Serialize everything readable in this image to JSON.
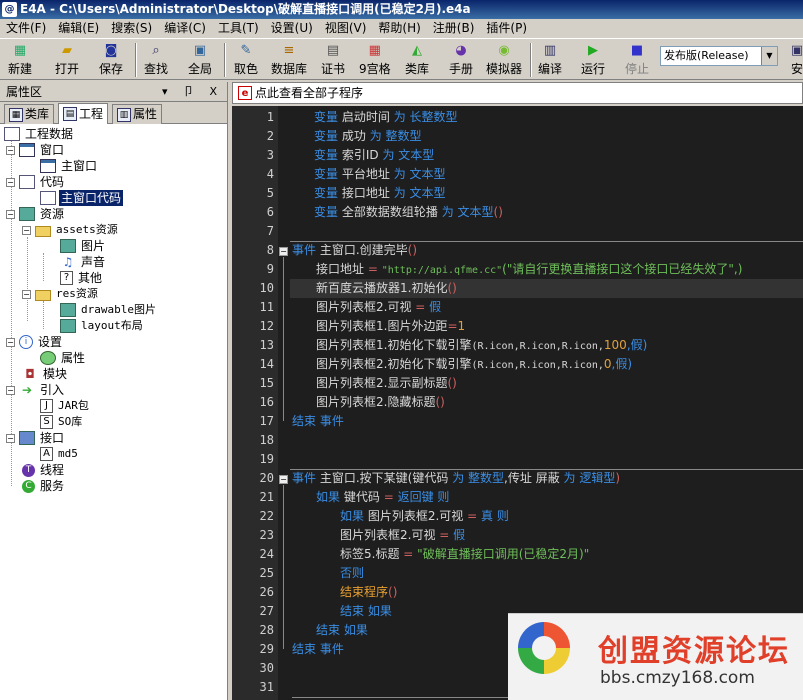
{
  "window": {
    "app_icon": "E4A",
    "title": "E4A - C:\\Users\\Administrator\\Desktop\\破解直播接口调用(已稳定2月).e4a"
  },
  "menu": [
    "文件(F)",
    "编辑(E)",
    "搜索(S)",
    "编译(C)",
    "工具(T)",
    "设置(U)",
    "视图(V)",
    "帮助(H)",
    "注册(B)",
    "插件(P)"
  ],
  "toolbar": {
    "new": "新建",
    "open": "打开",
    "save": "保存",
    "find": "查找",
    "global": "全局",
    "pick_color": "取色",
    "database": "数据库",
    "cert": "证书",
    "grid9": "9宫格",
    "library": "类库",
    "manual": "手册",
    "emulator": "模拟器",
    "compile": "编译",
    "run": "运行",
    "stop": "停止",
    "build_mode": "发布版(Release)",
    "install": "安"
  },
  "left_panel": {
    "title": "属性区",
    "controls": "▾ 卩 X",
    "tabs": {
      "library": "类库",
      "project": "工程",
      "properties": "属性"
    },
    "tree": {
      "root": "工程数据",
      "window": "窗口",
      "main_window": "主窗口",
      "code": "代码",
      "main_window_code": "主窗口代码",
      "resources": "资源",
      "assets": "assets资源",
      "image": "图片",
      "sound": "声音",
      "other": "其他",
      "res": "res资源",
      "drawable": "drawable图片",
      "layout": "layout布局",
      "settings": "设置",
      "attributes": "属性",
      "module": "模块",
      "import": "引入",
      "jar": "JAR包",
      "so": "SO库",
      "interface": "接口",
      "md5": "md5",
      "thread": "线程",
      "service": "服务"
    }
  },
  "editor_tab": {
    "label": "点此查看全部子程序",
    "icon": "E4A"
  },
  "code": {
    "line_numbers": [
      "1",
      "2",
      "3",
      "4",
      "5",
      "6",
      "7",
      "8",
      "9",
      "10",
      "11",
      "12",
      "13",
      "14",
      "15",
      "16",
      "17",
      "18",
      "19",
      "20",
      "21",
      "22",
      "23",
      "24",
      "25",
      "26",
      "27",
      "28",
      "29",
      "30",
      "31"
    ],
    "l1": {
      "kw": "变量",
      "name": "启动时间",
      "as": "为",
      "type": "长整数型"
    },
    "l2": {
      "kw": "变量",
      "name": "成功",
      "as": "为",
      "type": "整数型"
    },
    "l3": {
      "kw": "变量",
      "name": "索引ID",
      "as": "为",
      "type": "文本型"
    },
    "l4": {
      "kw": "变量",
      "name": "平台地址",
      "as": "为",
      "type": "文本型"
    },
    "l5": {
      "kw": "变量",
      "name": "接口地址",
      "as": "为",
      "type": "文本型"
    },
    "l6": {
      "kw": "变量",
      "name": "全部数据数组轮播",
      "as": "为",
      "type": "文本型",
      "arr": "()"
    },
    "l8": {
      "kw": "事件",
      "name": "主窗口.创建完毕",
      "paren": "()"
    },
    "l9": {
      "lhs": "接口地址",
      "eq": "=",
      "str1": "\"http://api.qfme.cc\"",
      "str2": "(\"请自行更换直播接口这个接口已经失效了\",)"
    },
    "l10": {
      "text": "新百度云播放器1.初始化",
      "paren": "()"
    },
    "l11": {
      "text": "图片列表框2.可视",
      "eq": "=",
      "val": "假"
    },
    "l12": {
      "text": "图片列表框1.图片外边距",
      "eq": "=",
      "val": "1"
    },
    "l13": {
      "text": "图片列表框1.初始化下载引擎",
      "args": "(R.icon,R.icon,R.icon,",
      "num": "100",
      "end": ",假)"
    },
    "l14": {
      "text": "图片列表框2.初始化下载引擎",
      "args": "(R.icon,R.icon,R.icon,",
      "num": "0",
      "end": ",假)"
    },
    "l15": {
      "text": "图片列表框2.显示副标题",
      "paren": "()"
    },
    "l16": {
      "text": "图片列表框2.隐藏标题",
      "paren": "()"
    },
    "l17": {
      "kw": "结束 事件"
    },
    "l20": {
      "kw": "事件",
      "name": "主窗口.按下某键",
      "p1": "(键代码",
      "as1": "为",
      "t1": "整数型",
      "p2": ",传址",
      "p3": "屏蔽",
      "as2": "为",
      "t2": "逻辑型",
      "close": ")"
    },
    "l21": {
      "kw": "如果",
      "lhs": "键代码",
      "eq": "=",
      "val": "返回键",
      "then": "则"
    },
    "l22": {
      "kw": "如果",
      "lhs": "图片列表框2.可视",
      "eq": "=",
      "val": "真",
      "then": "则"
    },
    "l23": {
      "lhs": "图片列表框2.可视",
      "eq": "=",
      "val": "假"
    },
    "l24": {
      "lhs": "标签5.标题",
      "eq": "=",
      "str": "\"破解直播接口调用(已稳定2月)\""
    },
    "l25": {
      "kw": "否则"
    },
    "l26": {
      "kw": "结束程序",
      "paren": "()"
    },
    "l27": {
      "kw": "结束 如果"
    },
    "l28": {
      "kw": "结束 如果"
    },
    "l29": {
      "kw": "结束 事件"
    }
  },
  "watermark": {
    "title": "创盟资源论坛",
    "url": "bbs.cmzy168.com"
  }
}
